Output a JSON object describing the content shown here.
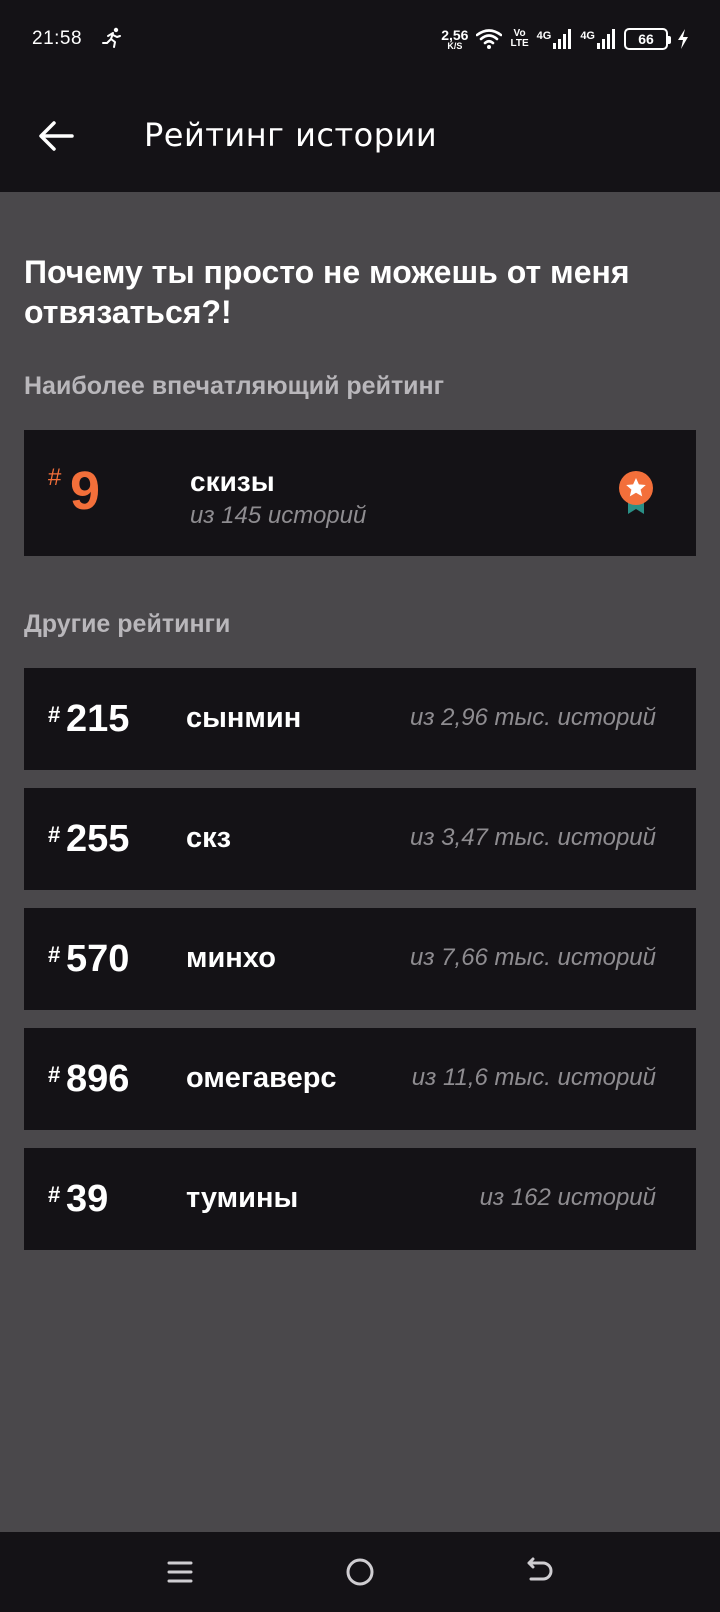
{
  "status_bar": {
    "time": "21:58",
    "speed_value": "2,56",
    "speed_unit": "K/S",
    "volte_top": "Vo",
    "volte_bottom": "LTE",
    "net1": "4G",
    "net2": "4G",
    "battery": "66",
    "icons": [
      "runner-icon",
      "wifi-icon",
      "signal-icon",
      "signal-icon",
      "battery-icon",
      "charging-icon"
    ]
  },
  "app_bar": {
    "title": "Рейтинг истории",
    "back_icon": "arrow-left-icon"
  },
  "story": {
    "title": "Почему ты просто не можешь от меня отвязаться?!"
  },
  "best": {
    "section_label": "Наиболее впечатляющий рейтинг",
    "hash": "#",
    "rank": "9",
    "tag": "скизы",
    "total": "из 145 историй",
    "icon": "medal-icon",
    "accent_color": "#f36f3a",
    "ribbon_color": "#2a8f86"
  },
  "others": {
    "section_label": "Другие рейтинги",
    "items": [
      {
        "hash": "#",
        "rank": "215",
        "tag": "сынмин",
        "total": "из 2,96 тыс. историй"
      },
      {
        "hash": "#",
        "rank": "255",
        "tag": "скз",
        "total": "из 3,47 тыс. историй"
      },
      {
        "hash": "#",
        "rank": "570",
        "tag": "минхо",
        "total": "из 7,66 тыс. историй"
      },
      {
        "hash": "#",
        "rank": "896",
        "tag": "омегаверс",
        "total": "из 11,6 тыс. историй"
      },
      {
        "hash": "#",
        "rank": "39",
        "tag": "тумины",
        "total": "из 162 историй"
      }
    ]
  },
  "nav_bar": {
    "icons": [
      "menu-icon",
      "home-circle-icon",
      "back-return-icon"
    ]
  }
}
